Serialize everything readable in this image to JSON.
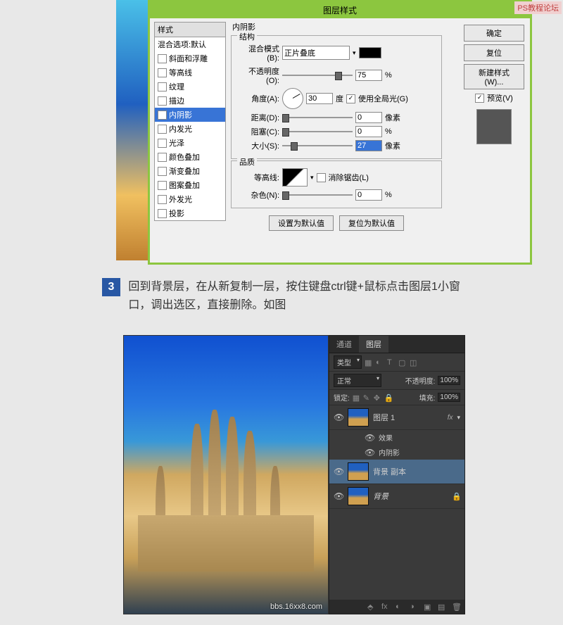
{
  "watermark_top": "PS教程论坛",
  "watermark_url": "bbs.16xx8.com",
  "dialog": {
    "title": "图层样式",
    "styles_header": "样式",
    "blend_default": "混合选项:默认",
    "items": [
      {
        "label": "斜面和浮雕",
        "checked": false
      },
      {
        "label": "等高线",
        "checked": false
      },
      {
        "label": "纹理",
        "checked": false
      },
      {
        "label": "描边",
        "checked": false
      },
      {
        "label": "内阴影",
        "checked": true,
        "selected": true
      },
      {
        "label": "内发光",
        "checked": false
      },
      {
        "label": "光泽",
        "checked": false
      },
      {
        "label": "颜色叠加",
        "checked": false
      },
      {
        "label": "渐变叠加",
        "checked": false
      },
      {
        "label": "图案叠加",
        "checked": false
      },
      {
        "label": "外发光",
        "checked": false
      },
      {
        "label": "投影",
        "checked": false
      }
    ],
    "section_title": "内阴影",
    "structure_label": "结构",
    "blend_mode_label": "混合模式(B):",
    "blend_mode_value": "正片叠底",
    "opacity_label": "不透明度(O):",
    "opacity_value": "75",
    "angle_label": "角度(A):",
    "angle_value": "30",
    "angle_unit": "度",
    "global_light": "使用全局光(G)",
    "distance_label": "距离(D):",
    "distance_value": "0",
    "choke_label": "阻塞(C):",
    "choke_value": "0",
    "size_label": "大小(S):",
    "size_value": "27",
    "px_unit": "像素",
    "pct_unit": "%",
    "quality_label": "品质",
    "contour_label": "等高线:",
    "antialias": "消除锯齿(L)",
    "noise_label": "杂色(N):",
    "noise_value": "0",
    "reset_default": "设置为默认值",
    "restore_default": "复位为默认值",
    "ok": "确定",
    "cancel": "复位",
    "new_style": "新建样式(W)...",
    "preview": "预览(V)"
  },
  "step": {
    "num": "3",
    "text": "回到背景层，在从新复制一层，按住键盘ctrl键+鼠标点击图层1小窗口，调出选区，直接删除。如图"
  },
  "layers": {
    "tab1": "通道",
    "tab2": "图层",
    "kind": "类型",
    "mode": "正常",
    "opacity_label": "不透明度:",
    "opacity_value": "100%",
    "lock_label": "锁定:",
    "fill_label": "填充:",
    "fill_value": "100%",
    "layer1": "图层 1",
    "fx": "fx",
    "effects": "效果",
    "inner_shadow": "内阴影",
    "bg_copy": "背景 副本",
    "bg": "背景"
  }
}
